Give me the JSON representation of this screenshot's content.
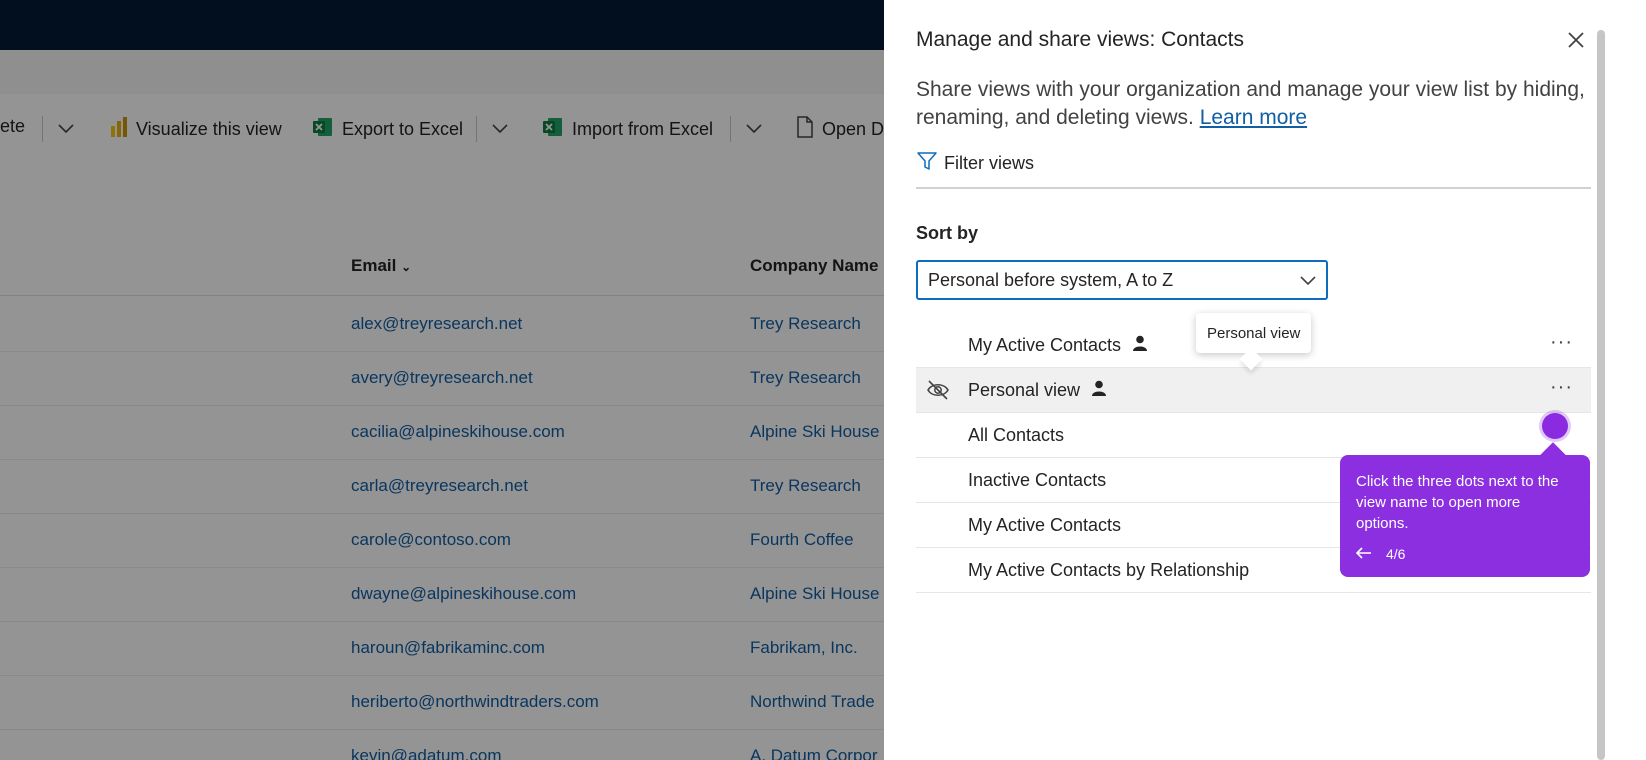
{
  "command_bar": {
    "delete_partial": "ete",
    "visualize": "Visualize this view",
    "export": "Export to Excel",
    "import": "Import from Excel",
    "open_partial": "Open D"
  },
  "grid": {
    "columns": [
      "Email",
      "Company Name"
    ],
    "rows": [
      {
        "email": "alex@treyresearch.net",
        "company": "Trey Research"
      },
      {
        "email": "avery@treyresearch.net",
        "company": "Trey Research"
      },
      {
        "email": "cacilia@alpineskihouse.com",
        "company": "Alpine Ski House"
      },
      {
        "email": "carla@treyresearch.net",
        "company": "Trey Research"
      },
      {
        "email": "carole@contoso.com",
        "company": "Fourth Coffee"
      },
      {
        "email": "dwayne@alpineskihouse.com",
        "company": "Alpine Ski House"
      },
      {
        "email": "haroun@fabrikaminc.com",
        "company": "Fabrikam, Inc."
      },
      {
        "email": "heriberto@northwindtraders.com",
        "company": "Northwind Trade"
      },
      {
        "email": "kevin@adatum.com",
        "company": "A. Datum Corpor"
      }
    ]
  },
  "panel": {
    "title": "Manage and share views: Contacts",
    "description": "Share views with your organization and manage your view list by hiding, renaming, and deleting views.",
    "learn_more": "Learn more",
    "filter_label": "Filter views",
    "sort_label": "Sort by",
    "sort_value": "Personal before system, A to Z",
    "views": [
      {
        "name": "My Active Contacts",
        "personal": true
      },
      {
        "name": "Personal view",
        "personal": true,
        "hidden": true
      },
      {
        "name": "All Contacts",
        "personal": false
      },
      {
        "name": "Inactive Contacts",
        "personal": false
      },
      {
        "name": "My Active Contacts",
        "personal": false
      },
      {
        "name": "My Active Contacts by Relationship",
        "personal": false
      }
    ],
    "more_label": "···",
    "tooltip": "Personal view"
  },
  "guide": {
    "text": "Click the three dots next to the view name to open more options.",
    "step": "4/6",
    "back_icon": "arrow-left-icon",
    "color": "#8b2fe0"
  }
}
